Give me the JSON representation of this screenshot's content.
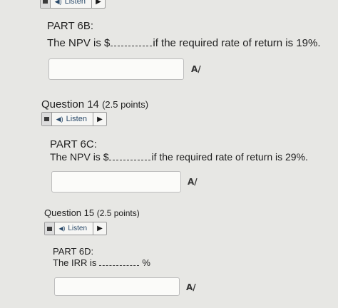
{
  "top_listen": {
    "label": "Listen",
    "play_glyph": "▶"
  },
  "part6b": {
    "title": "PART 6B:",
    "text_before": "The NPV is $",
    "text_after": "if the required rate of return is 19%."
  },
  "q14": {
    "heading": "Question 14",
    "points": "(2.5 points)",
    "listen_label": "Listen",
    "play_glyph": "▶",
    "part_title": "PART 6C:",
    "text_before": "The NPV is $",
    "text_after": "if the required rate of return is 29%."
  },
  "q15": {
    "heading": "Question 15",
    "points": "(2.5 points)",
    "listen_label": "Listen",
    "play_glyph": "▶",
    "part_title": "PART 6D:",
    "text_before": "The IRR is",
    "text_after": "%"
  },
  "icons": {
    "spellcheck": "A/",
    "speaker": "speaker-icon"
  }
}
